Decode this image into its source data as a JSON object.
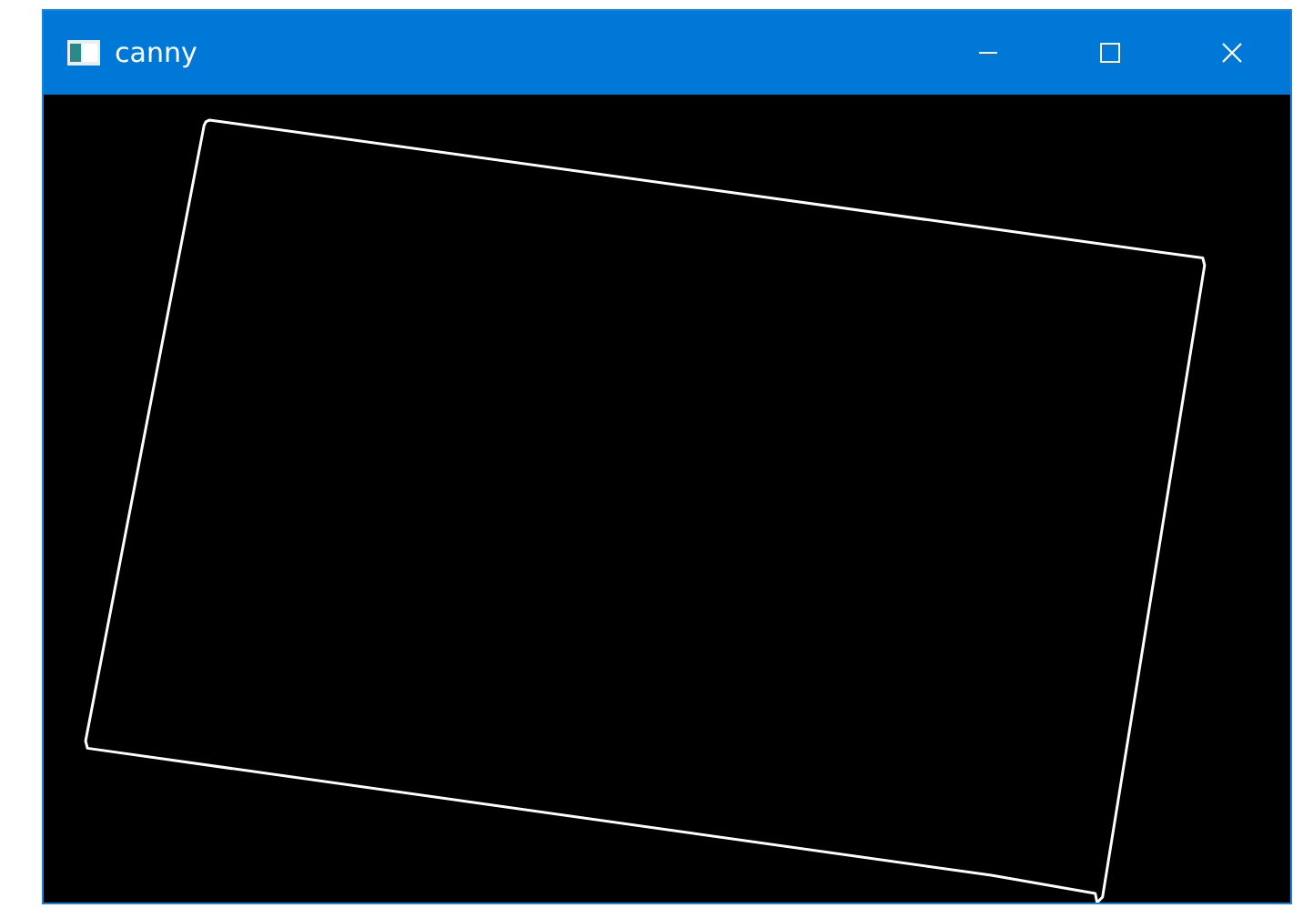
{
  "window": {
    "title": "canny"
  }
}
